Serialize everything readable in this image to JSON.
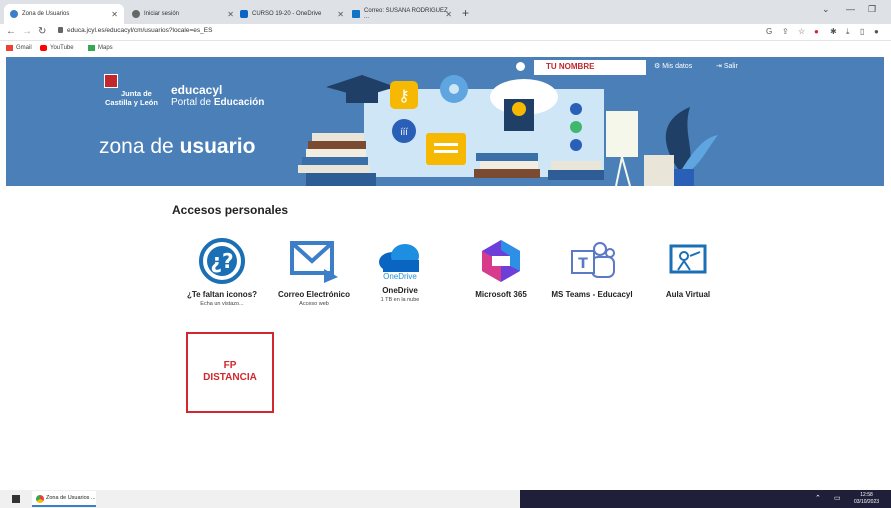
{
  "browser": {
    "tabs": [
      {
        "label": "Zona de Usuarios"
      },
      {
        "label": "Iniciar sesión"
      },
      {
        "label": "CURSO 19-20 - OneDrive"
      },
      {
        "label": "Correo: SUSANA RODRIGUEZ ..."
      }
    ],
    "url": "educa.jcyl.es/educacyl/cm/usuarios?locale=es_ES",
    "bookmarks": [
      {
        "label": "Gmail"
      },
      {
        "label": "YouTube"
      },
      {
        "label": "Maps"
      }
    ]
  },
  "header": {
    "junta_line1": "Junta de",
    "junta_line2": "Castilla y León",
    "brand": "educacyl",
    "portal_prefix": "Portal de ",
    "portal_bold": "Educación",
    "zona_prefix": "zona de ",
    "zona_bold": "usuario",
    "user_name": "TU NOMBRE",
    "mis_datos": "Mis datos",
    "salir": "Salir"
  },
  "main": {
    "section_title": "Accesos personales",
    "apps": [
      {
        "label": "¿Te faltan iconos?",
        "sub": "Echa un vistazo..."
      },
      {
        "label": "Correo Electrónico",
        "sub": "Acceso web"
      },
      {
        "label": "OneDrive",
        "sub": "1 TB en la nube",
        "icon_text": "OneDrive"
      },
      {
        "label": "Microsoft 365",
        "sub": ""
      },
      {
        "label": "MS Teams - Educacyl",
        "sub": ""
      },
      {
        "label": "Aula Virtual",
        "sub": ""
      }
    ],
    "fp_line1": "FP",
    "fp_line2": "DISTANCIA"
  },
  "taskbar": {
    "app_label": "Zona de Usuarios ...",
    "time": "12:58",
    "date": "03/10/2023"
  },
  "colors": {
    "banner": "#4a7fb8",
    "accent_red": "#d0282d",
    "icon_blue": "#1a6fb5"
  }
}
